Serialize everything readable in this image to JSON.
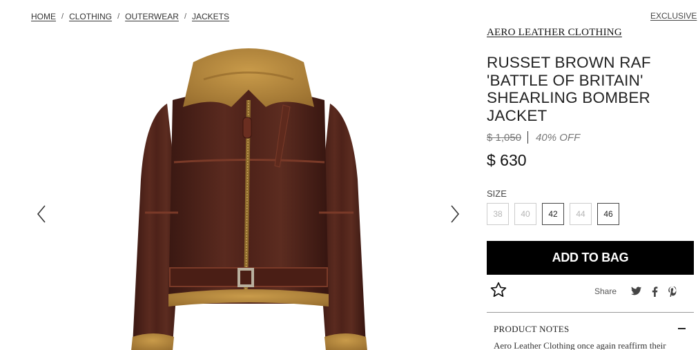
{
  "breadcrumb": {
    "items": [
      "HOME",
      "CLOTHING",
      "OUTERWEAR",
      "JACKETS"
    ],
    "separator": "/"
  },
  "badge": {
    "label": "EXCLUSIVE"
  },
  "product": {
    "brand": "AERO LEATHER CLOTHING",
    "title": "RUSSET BROWN RAF 'BATTLE OF BRITAIN' SHEARLING BOMBER JACKET",
    "original_price": "$ 1,050",
    "discount": "40% OFF",
    "price": "$ 630"
  },
  "size": {
    "label": "SIZE",
    "options": [
      {
        "value": "38",
        "available": false
      },
      {
        "value": "40",
        "available": false
      },
      {
        "value": "42",
        "available": true
      },
      {
        "value": "44",
        "available": false
      },
      {
        "value": "46",
        "available": true
      }
    ]
  },
  "actions": {
    "add_to_bag": "ADD TO BAG",
    "share_label": "Share",
    "wishlist_icon": "star-outline-icon",
    "social_icons": [
      "twitter-icon",
      "facebook-icon",
      "pinterest-icon"
    ]
  },
  "product_notes": {
    "title": "PRODUCT NOTES",
    "text": "Aero Leather Clothing once again reaffirm their"
  },
  "gallery": {
    "prev_icon": "chevron-left-icon",
    "next_icon": "chevron-right-icon"
  },
  "colors": {
    "button_bg": "#000000",
    "leather": "#4a2119",
    "shearling": "#b88a3c"
  }
}
